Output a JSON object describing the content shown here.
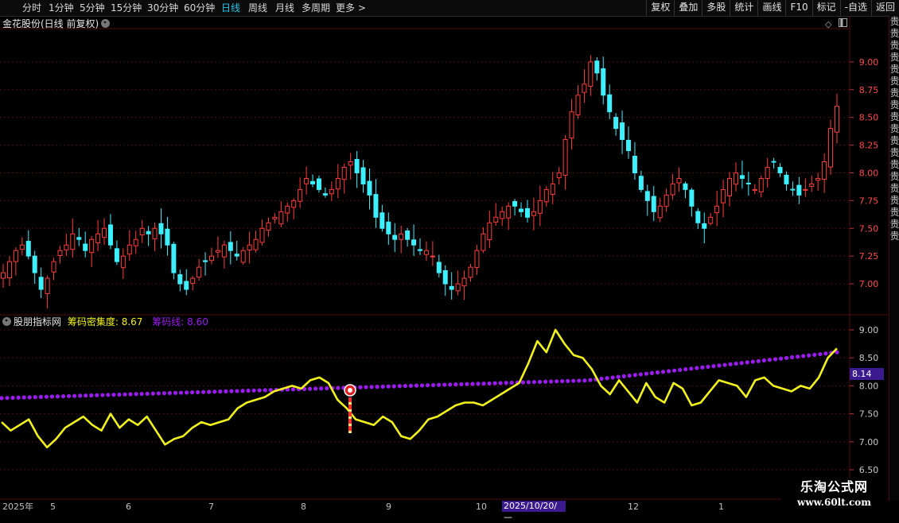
{
  "toolbar": {
    "periods": [
      "分时",
      "1分钟",
      "5分钟",
      "15分钟",
      "30分钟",
      "60分钟",
      "日线",
      "周线",
      "月线",
      "多周期",
      "更多 >"
    ],
    "active_period": "日线",
    "buttons": [
      "复权",
      "叠加",
      "多股",
      "统计",
      "画线",
      "F10",
      "标记",
      "-自选",
      "返回"
    ]
  },
  "main_panel": {
    "title": "金花股份(日线 前复权)",
    "price_ticks": [
      "9.00",
      "8.75",
      "8.50",
      "8.25",
      "8.00",
      "7.75",
      "7.50",
      "7.25",
      "7.00"
    ]
  },
  "indicator_panel": {
    "name": "股朋指标网",
    "series": [
      {
        "label": "筹码密集度: 8.67",
        "color": "#f2f21c"
      },
      {
        "label": "筹码线: 8.60",
        "color": "#9b1cf0"
      }
    ],
    "ticks": [
      "9.00",
      "8.50",
      "8.00",
      "7.50",
      "7.00",
      "6.50"
    ],
    "current_value": "8.14",
    "signal_icon": "buy-signal-icon"
  },
  "date_axis": {
    "labels": [
      "2025年",
      "5",
      "6",
      "7",
      "8",
      "9",
      "10",
      "12",
      "1"
    ],
    "cursor_label": "2025/10/20/—"
  },
  "right_strip": {
    "chars": [
      "贵",
      "贵",
      "贵",
      "贵",
      "贵",
      "贵",
      "贵",
      "贵",
      "贵",
      "贵",
      "贵",
      "贵",
      "贵",
      "贵",
      "贵",
      "贵",
      "贵",
      "贵",
      "贵"
    ]
  },
  "watermark": {
    "title": "乐淘公式网",
    "url": "www.60lt.com"
  },
  "colors": {
    "up": "#ff3c3c",
    "down": "#3cf0ff",
    "grid": "#4a0e0e",
    "yellow": "#f2f21c",
    "purple": "#9b1cf0"
  },
  "chart_data": {
    "type": "candlestick",
    "main_ylim": [
      6.8,
      9.3
    ],
    "indicator_ylim": [
      6.4,
      9.1
    ],
    "candles_close_path": [
      7.1,
      7.2,
      7.3,
      7.35,
      7.25,
      7.1,
      6.95,
      7.05,
      7.2,
      7.3,
      7.35,
      7.45,
      7.4,
      7.3,
      7.4,
      7.45,
      7.5,
      7.35,
      7.2,
      7.25,
      7.35,
      7.4,
      7.5,
      7.45,
      7.5,
      7.45,
      7.35,
      7.1,
      7.0,
      6.95,
      7.05,
      7.15,
      7.2,
      7.25,
      7.3,
      7.35,
      7.3,
      7.25,
      7.3,
      7.35,
      7.4,
      7.5,
      7.55,
      7.6,
      7.65,
      7.7,
      7.75,
      7.85,
      7.95,
      7.9,
      7.85,
      7.8,
      7.85,
      7.95,
      8.05,
      8.1,
      8.0,
      7.9,
      7.8,
      7.6,
      7.5,
      7.45,
      7.4,
      7.45,
      7.4,
      7.35,
      7.3,
      7.3,
      7.25,
      7.1,
      7.0,
      6.95,
      7.0,
      7.05,
      7.15,
      7.3,
      7.45,
      7.55,
      7.6,
      7.65,
      7.7,
      7.7,
      7.65,
      7.6,
      7.65,
      7.75,
      7.85,
      7.9,
      8.0,
      8.3,
      8.55,
      8.7,
      8.8,
      9.0,
      8.9,
      8.7,
      8.55,
      8.4,
      8.3,
      8.2,
      8.0,
      7.85,
      7.75,
      7.65,
      7.7,
      7.8,
      7.9,
      7.95,
      7.85,
      7.7,
      7.55,
      7.5,
      7.6,
      7.7,
      7.85,
      7.95,
      8.0,
      7.95,
      7.9,
      7.85,
      7.95,
      8.05,
      8.1,
      8.0,
      7.9,
      7.85,
      7.8,
      7.85,
      7.9,
      7.95,
      8.1,
      8.4,
      8.6
    ],
    "yellow_line": [
      7.35,
      7.2,
      7.3,
      7.4,
      7.1,
      6.9,
      7.05,
      7.25,
      7.35,
      7.45,
      7.3,
      7.2,
      7.5,
      7.25,
      7.4,
      7.3,
      7.45,
      7.2,
      6.95,
      7.05,
      7.1,
      7.25,
      7.35,
      7.3,
      7.35,
      7.4,
      7.6,
      7.7,
      7.75,
      7.8,
      7.9,
      7.95,
      8.0,
      7.95,
      8.1,
      8.15,
      8.05,
      7.75,
      7.6,
      7.4,
      7.35,
      7.3,
      7.45,
      7.35,
      7.1,
      7.05,
      7.2,
      7.4,
      7.45,
      7.55,
      7.65,
      7.7,
      7.7,
      7.65,
      7.75,
      7.85,
      7.95,
      8.05,
      8.4,
      8.8,
      8.6,
      9.0,
      8.75,
      8.55,
      8.5,
      8.3,
      8.0,
      7.85,
      8.1,
      7.9,
      7.7,
      8.05,
      7.8,
      7.7,
      8.05,
      7.95,
      7.65,
      7.7,
      7.9,
      8.1,
      8.05,
      8.0,
      7.8,
      8.1,
      8.15,
      8.0,
      7.95,
      7.9,
      8.0,
      7.95,
      8.15,
      8.5,
      8.67
    ],
    "purple_line": {
      "start": 7.78,
      "end": 8.6
    },
    "x_labels": [
      "2025年",
      "5",
      "6",
      "7",
      "8",
      "9",
      "10",
      "12",
      "1"
    ]
  }
}
